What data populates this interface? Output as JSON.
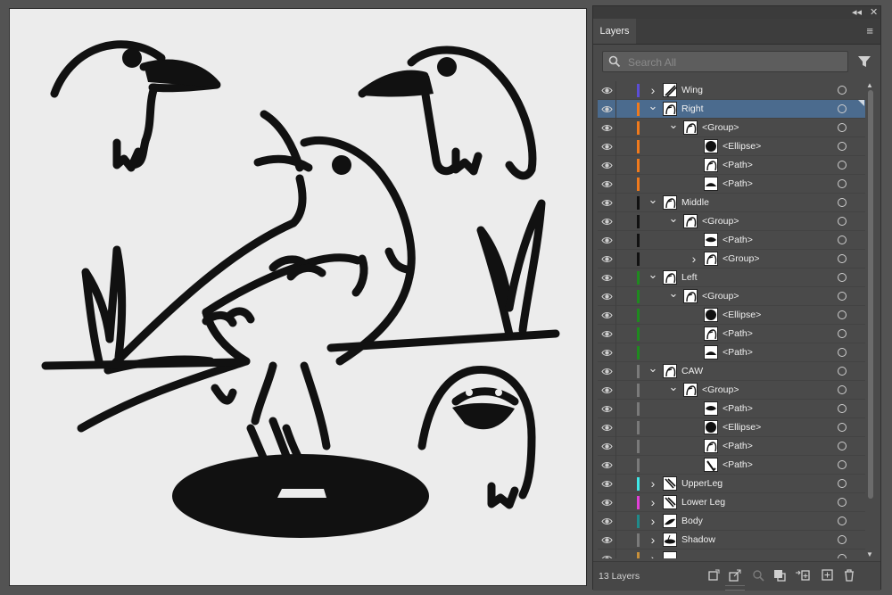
{
  "panel": {
    "tab_label": "Layers",
    "collapse_glyph": "◂◂",
    "close_glyph": "✕",
    "menu_glyph": "≡",
    "search_placeholder": "Search All",
    "layer_count": "13 Layers"
  },
  "colors": {
    "canvas_bg": "#ececec",
    "ink": "#111111",
    "selected_row": "#4b6b8e"
  },
  "layers": [
    {
      "label": "Wing",
      "depth": 0,
      "twist": ">",
      "color": "#5b4ed6",
      "thumb": "wing",
      "vis": true
    },
    {
      "label": "Right",
      "depth": 0,
      "twist": "v",
      "color": "#f07a1c",
      "thumb": "bird",
      "vis": true,
      "selected": true
    },
    {
      "label": "<Group>",
      "depth": 1,
      "twist": "v",
      "color": "#f07a1c",
      "thumb": "bird",
      "vis": true
    },
    {
      "label": "<Ellipse>",
      "depth": 2,
      "twist": "",
      "color": "#f07a1c",
      "thumb": "ellipse",
      "vis": true
    },
    {
      "label": "<Path>",
      "depth": 2,
      "twist": "",
      "color": "#f07a1c",
      "thumb": "bird",
      "vis": true
    },
    {
      "label": "<Path>",
      "depth": 2,
      "twist": "",
      "color": "#f07a1c",
      "thumb": "wave",
      "vis": true
    },
    {
      "label": "Middle",
      "depth": 0,
      "twist": "v",
      "color": "#111111",
      "thumb": "bird",
      "vis": true
    },
    {
      "label": "<Group>",
      "depth": 1,
      "twist": "v",
      "color": "#111111",
      "thumb": "bird",
      "vis": true
    },
    {
      "label": "<Path>",
      "depth": 2,
      "twist": "",
      "color": "#111111",
      "thumb": "beak",
      "vis": true
    },
    {
      "label": "<Group>",
      "depth": 2,
      "twist": ">",
      "color": "#111111",
      "thumb": "bird",
      "vis": true
    },
    {
      "label": "Left",
      "depth": 0,
      "twist": "v",
      "color": "#1f8a1f",
      "thumb": "bird",
      "vis": true
    },
    {
      "label": "<Group>",
      "depth": 1,
      "twist": "v",
      "color": "#1f8a1f",
      "thumb": "bird",
      "vis": true
    },
    {
      "label": "<Ellipse>",
      "depth": 2,
      "twist": "",
      "color": "#1f8a1f",
      "thumb": "ellipse",
      "vis": true
    },
    {
      "label": "<Path>",
      "depth": 2,
      "twist": "",
      "color": "#1f8a1f",
      "thumb": "bird",
      "vis": true
    },
    {
      "label": "<Path>",
      "depth": 2,
      "twist": "",
      "color": "#1f8a1f",
      "thumb": "wave",
      "vis": true
    },
    {
      "label": "CAW",
      "depth": 0,
      "twist": "v",
      "color": "#7a7a7a",
      "thumb": "bird",
      "vis": true
    },
    {
      "label": "<Group>",
      "depth": 1,
      "twist": "v",
      "color": "#7a7a7a",
      "thumb": "bird",
      "vis": true
    },
    {
      "label": "<Path>",
      "depth": 2,
      "twist": "",
      "color": "#7a7a7a",
      "thumb": "beak",
      "vis": true
    },
    {
      "label": "<Ellipse>",
      "depth": 2,
      "twist": "",
      "color": "#7a7a7a",
      "thumb": "ellipse",
      "vis": true
    },
    {
      "label": "<Path>",
      "depth": 2,
      "twist": "",
      "color": "#7a7a7a",
      "thumb": "bird",
      "vis": true
    },
    {
      "label": "<Path>",
      "depth": 2,
      "twist": "",
      "color": "#7a7a7a",
      "thumb": "leg",
      "vis": true
    },
    {
      "label": "UpperLeg",
      "depth": 0,
      "twist": ">",
      "color": "#3fe8e8",
      "thumb": "legs",
      "vis": true
    },
    {
      "label": "Lower Leg",
      "depth": 0,
      "twist": ">",
      "color": "#e040d8",
      "thumb": "legs",
      "vis": true
    },
    {
      "label": "Body",
      "depth": 0,
      "twist": ">",
      "color": "#1f8a8a",
      "thumb": "body",
      "vis": true
    },
    {
      "label": "Shadow",
      "depth": 0,
      "twist": ">",
      "color": "#7a7a7a",
      "thumb": "shadow",
      "vis": true
    },
    {
      "label": "",
      "depth": 0,
      "twist": ">",
      "color": "#c8903a",
      "thumb": "blank",
      "vis": true
    }
  ],
  "footer_icons": [
    "collect-export-icon",
    "export-icon",
    "locate-object-icon",
    "make-clipping-mask-icon",
    "new-sublayer-icon",
    "new-layer-icon",
    "trash-icon"
  ]
}
